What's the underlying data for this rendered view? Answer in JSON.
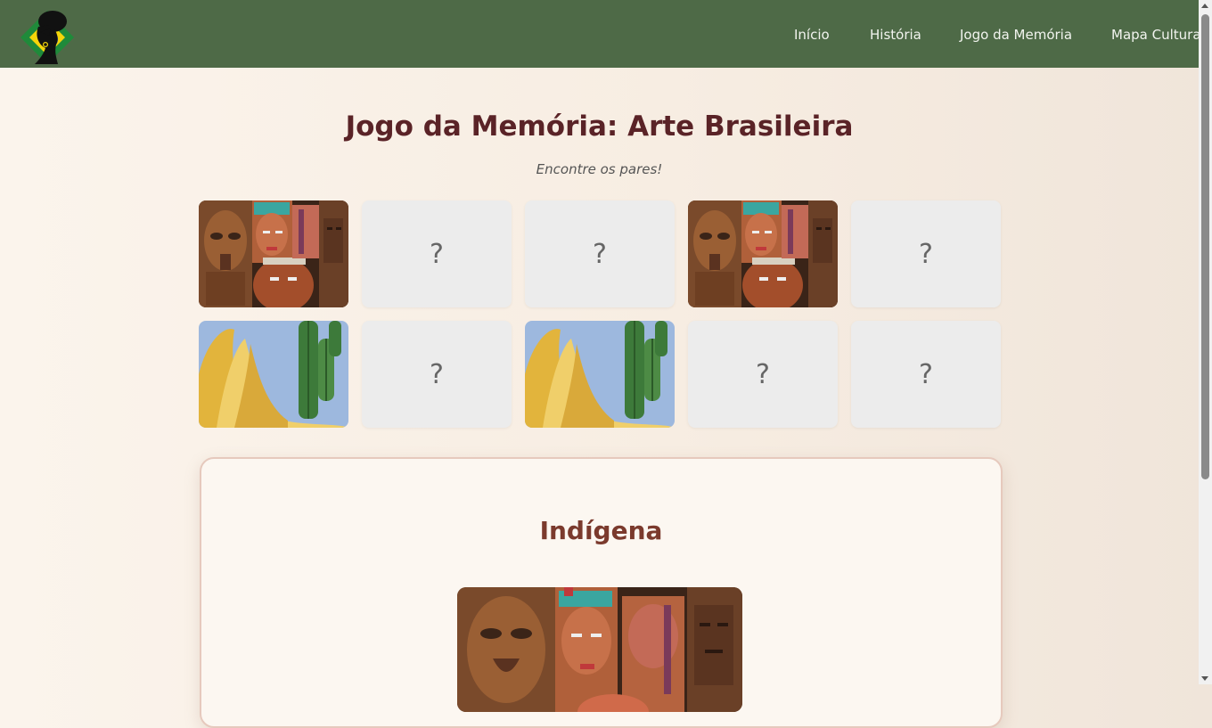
{
  "nav": {
    "items": [
      {
        "label": "Início"
      },
      {
        "label": "História"
      },
      {
        "label": "Jogo da Memória"
      },
      {
        "label": "Mapa Cultural"
      }
    ]
  },
  "game": {
    "title": "Jogo da Memória: Arte Brasileira",
    "subtitle": "Encontre os pares!",
    "hidden_symbol": "?",
    "cards": [
      {
        "state": "revealed",
        "image": "indigenous-masks"
      },
      {
        "state": "hidden"
      },
      {
        "state": "hidden"
      },
      {
        "state": "revealed",
        "image": "indigenous-masks"
      },
      {
        "state": "hidden"
      },
      {
        "state": "revealed",
        "image": "modernist-cactus-painting"
      },
      {
        "state": "hidden"
      },
      {
        "state": "revealed",
        "image": "modernist-cactus-painting"
      },
      {
        "state": "hidden"
      },
      {
        "state": "hidden"
      }
    ]
  },
  "info": {
    "title": "Indígena",
    "image": "indigenous-masks"
  },
  "colors": {
    "navbar": "#4e6a47",
    "title": "#5a2327",
    "info_title": "#7b3a2d",
    "card_back": "#ececec"
  }
}
